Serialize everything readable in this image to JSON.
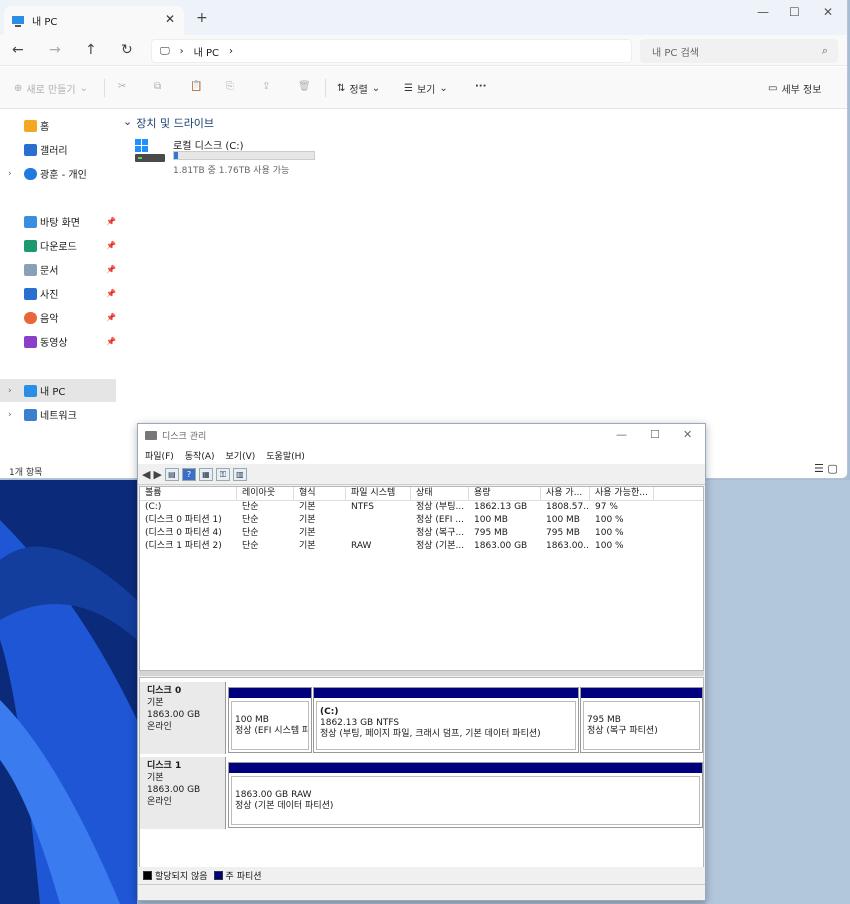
{
  "explorer": {
    "tab_title": "내 PC",
    "breadcrumb": "내 PC",
    "search_placeholder": "내 PC 검색",
    "toolbar": {
      "new": "새로 만들기",
      "sort": "정렬",
      "view": "보기",
      "more": "···",
      "details": "세부 정보"
    },
    "nav": {
      "home": "홈",
      "gallery": "갤러리",
      "onedrive": "광훈 - 개인",
      "desktop": "바탕 화면",
      "downloads": "다운로드",
      "documents": "문서",
      "pictures": "사진",
      "music": "음악",
      "videos": "동영상",
      "thispc": "내 PC",
      "network": "네트워크"
    },
    "section_title": "장치 및 드라이브",
    "drive": {
      "name": "로컬 디스크 (C:)",
      "free_text": "1.81TB 중 1.76TB 사용 가능",
      "used_fraction": 0.03
    },
    "status": "1개 항목"
  },
  "disk_mgmt": {
    "title": "디스크 관리",
    "menu": [
      "파일(F)",
      "동작(A)",
      "보기(V)",
      "도움말(H)"
    ],
    "columns": [
      "볼륨",
      "레이아웃",
      "형식",
      "파일 시스템",
      "상태",
      "용량",
      "사용 가...",
      "사용 가능한..."
    ],
    "rows": [
      [
        "(C:)",
        "단순",
        "기본",
        "NTFS",
        "정상 (부팅...",
        "1862.13 GB",
        "1808.57...",
        "97 %"
      ],
      [
        "(디스크 0 파티션 1)",
        "단순",
        "기본",
        "",
        "정상 (EFI ...",
        "100 MB",
        "100 MB",
        "100 %"
      ],
      [
        "(디스크 0 파티션 4)",
        "단순",
        "기본",
        "",
        "정상 (복구...",
        "795 MB",
        "795 MB",
        "100 %"
      ],
      [
        "(디스크 1 파티션 2)",
        "단순",
        "기본",
        "RAW",
        "정상 (기본...",
        "1863.00 GB",
        "1863.00...",
        "100 %"
      ]
    ],
    "disk0": {
      "name": "디스크 0",
      "type": "기본",
      "size": "1863.00 GB",
      "state": "온라인",
      "p1_size": "100 MB",
      "p1_status": "정상 (EFI 시스템 파",
      "p2_label": "(C:)",
      "p2_size": "1862.13 GB NTFS",
      "p2_status": "정상 (부팅, 페이지 파일, 크래시 덤프, 기본 데이터 파티션)",
      "p3_size": "795 MB",
      "p3_status": "정상 (복구 파티션)"
    },
    "disk1": {
      "name": "디스크 1",
      "type": "기본",
      "size": "1863.00 GB",
      "state": "온라인",
      "p1_size": "1863.00 GB RAW",
      "p1_status": "정상 (기본 데이터 파티션)"
    },
    "legend": {
      "unallocated": "할당되지 않음",
      "primary": "주 파티션"
    }
  }
}
